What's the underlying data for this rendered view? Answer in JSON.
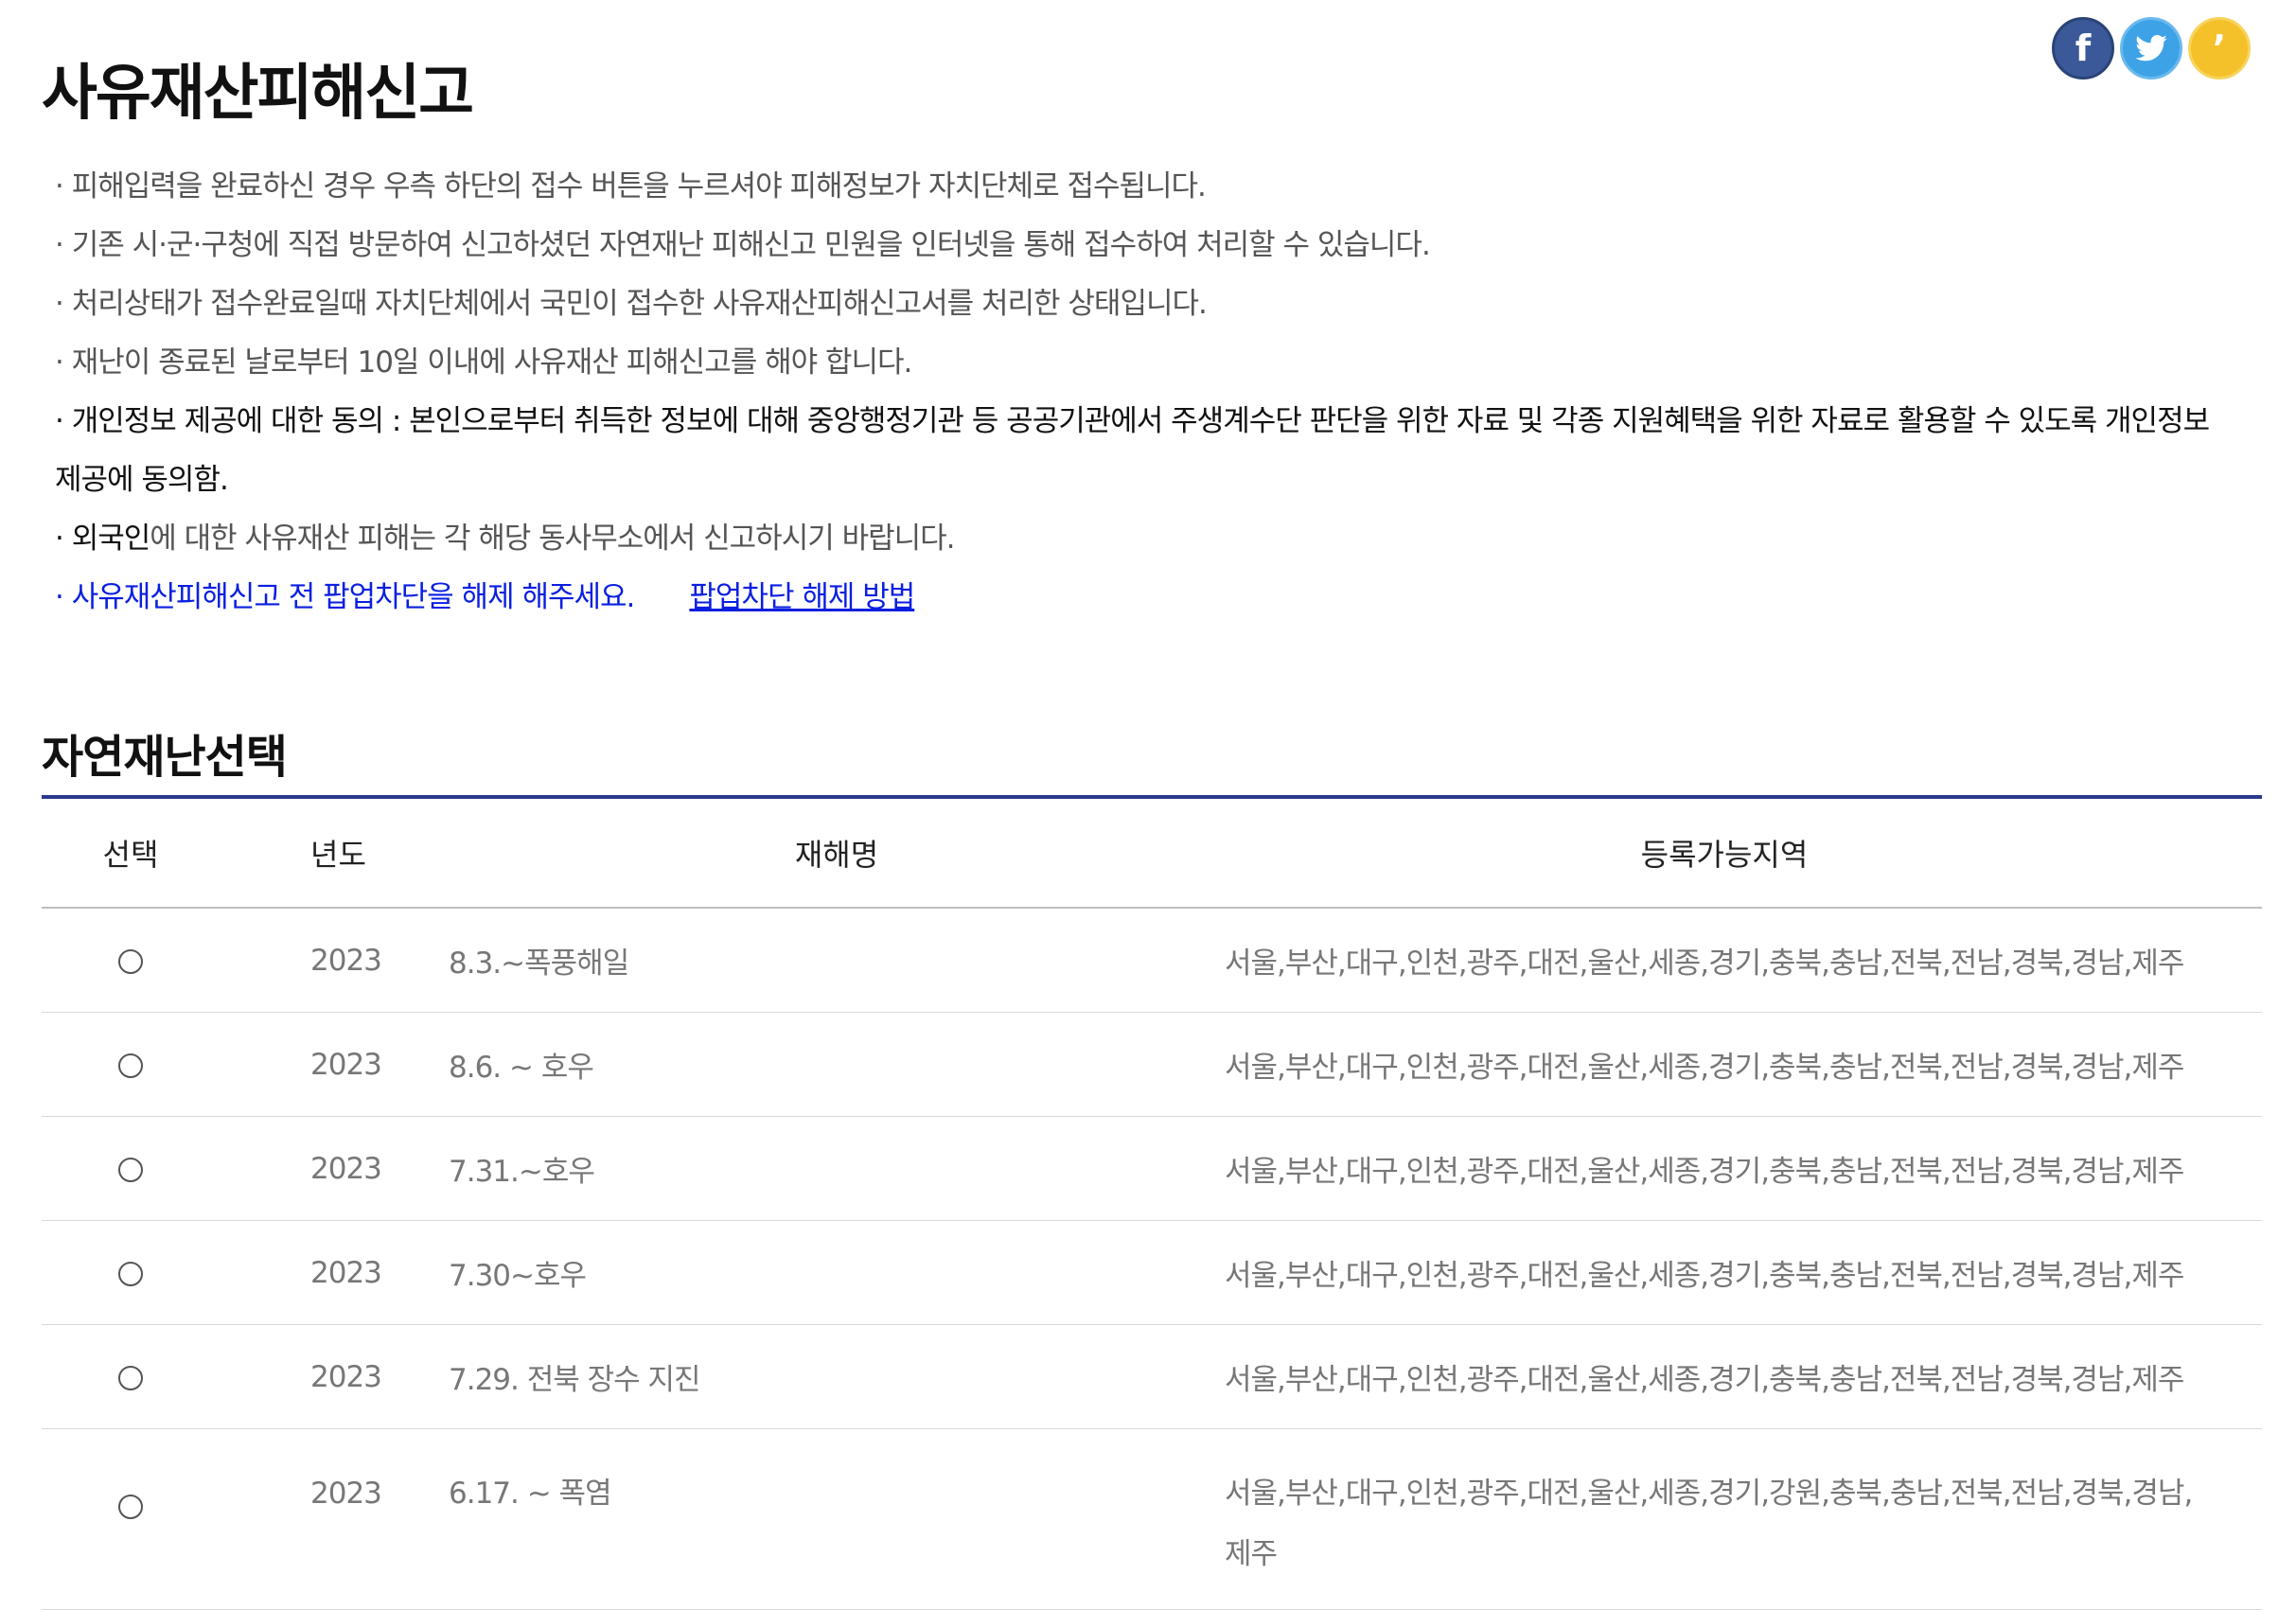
{
  "page": {
    "title": "사유재산피해신고"
  },
  "social": {
    "facebook_label": "f",
    "twitter_label": "t",
    "kakaostory_label": "ʼ"
  },
  "notices": [
    "· 피해입력을 완료하신 경우 우측 하단의 접수 버튼을 누르셔야 피해정보가 자치단체로 접수됩니다.",
    "· 기존 시·군·구청에 직접 방문하여 신고하셨던 자연재난 피해신고 민원을 인터넷을 통해 접수하여 처리할 수 있습니다.",
    "· 처리상태가 접수완료일때 자치단체에서 국민이 접수한 사유재산피해신고서를 처리한 상태입니다.",
    "· 재난이 종료된 날로부터 10일 이내에 사유재산 피해신고를 해야 합니다.",
    "· 개인정보 제공에 대한 동의 : 본인으로부터 취득한 정보에 대해 중앙행정기관 등 공공기관에서 주생계수단 판단을 위한 자료 및 각종 지원혜택을 위한 자료로 활용할 수 있도록 개인정보 제공에 동의함."
  ],
  "foreigner_notice": {
    "highlight": "· 외국인",
    "rest": "에 대한 사유재산 피해는 각 해당 동사무소에서 신고하시기 바랍니다."
  },
  "popup_notice": {
    "text": "· 사유재산피해신고 전 팝업차단을 해제 해주세요.",
    "link": "팝업차단 해제 방법"
  },
  "disaster_section": {
    "title": "자연재난선택",
    "columns": [
      "선택",
      "년도",
      "재해명",
      "등록가능지역"
    ],
    "rows": [
      {
        "year": "2023",
        "name": "8.3.~폭풍해일",
        "areas": "서울,부산,대구,인천,광주,대전,울산,세종,경기,충북,충남,전북,전남,경북,경남,제주"
      },
      {
        "year": "2023",
        "name": "8.6. ~ 호우",
        "areas": "서울,부산,대구,인천,광주,대전,울산,세종,경기,충북,충남,전북,전남,경북,경남,제주"
      },
      {
        "year": "2023",
        "name": "7.31.~호우",
        "areas": "서울,부산,대구,인천,광주,대전,울산,세종,경기,충북,충남,전북,전남,경북,경남,제주"
      },
      {
        "year": "2023",
        "name": "7.30~호우",
        "areas": "서울,부산,대구,인천,광주,대전,울산,세종,경기,충북,충남,전북,전남,경북,경남,제주"
      },
      {
        "year": "2023",
        "name": "7.29. 전북 장수 지진",
        "areas": "서울,부산,대구,인천,광주,대전,울산,세종,경기,충북,충남,전북,전남,경북,경남,제주"
      },
      {
        "year": "2023",
        "name": "6.17. ~ 폭염",
        "areas": "서울,부산,대구,인천,광주,대전,울산,세종,경기,강원,충북,충남,전북,전남,경북,경남, 제주"
      }
    ]
  }
}
